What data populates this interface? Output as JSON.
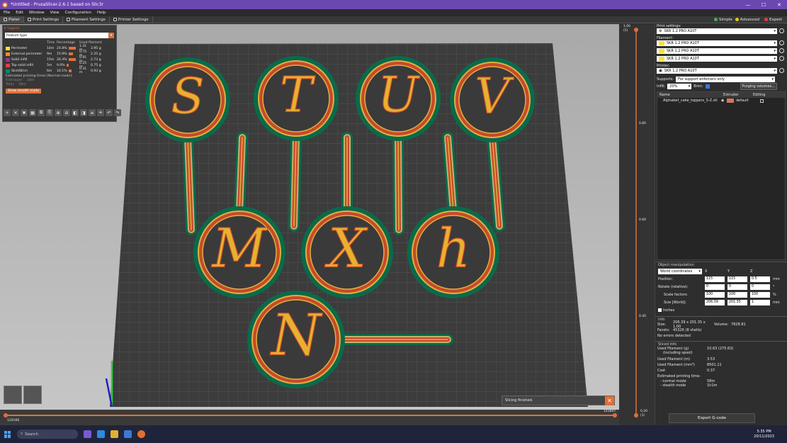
{
  "window": {
    "title": "*Untitled - PrusaSlicer-2.6.1 based on Slic3r",
    "minimize": "—",
    "maximize": "☐",
    "close": "✕"
  },
  "menu": [
    "File",
    "Edit",
    "Window",
    "View",
    "Configuration",
    "Help"
  ],
  "tabs": [
    {
      "label": "Plater",
      "icon": "plater-icon"
    },
    {
      "label": "Print Settings",
      "icon": "print-settings-icon"
    },
    {
      "label": "Filament Settings",
      "icon": "filament-icon"
    },
    {
      "label": "Printer Settings",
      "icon": "printer-icon"
    }
  ],
  "modes": [
    {
      "label": "Simple",
      "color": "#4caf50"
    },
    {
      "label": "Advanced",
      "color": "#f0c419"
    },
    {
      "label": "Expert",
      "color": "#e0403a"
    }
  ],
  "legend": {
    "title": "Legend",
    "view_type": "Feature type",
    "headers": {
      "time": "Time",
      "percentage": "Percentage",
      "used": "Used filament"
    },
    "rows": [
      {
        "name": "Perimeter",
        "color": "#f7e23a",
        "time": "14m",
        "pct": "24.8%",
        "pct_value": 24.8,
        "len": "1.31 m",
        "weight": "3.95 g"
      },
      {
        "name": "External perimeter",
        "color": "#f28c28",
        "time": "9m",
        "pct": "15.9%",
        "pct_value": 15.9,
        "len": "0.75 m",
        "weight": "2.25 g"
      },
      {
        "name": "Solid infill",
        "color": "#a03090",
        "time": "15m",
        "pct": "26.4%",
        "pct_value": 26.4,
        "len": "0.91 m",
        "weight": "2.73 g"
      },
      {
        "name": "Top solid infill",
        "color": "#e04040",
        "time": "5m",
        "pct": "9.0%",
        "pct_value": 9.0,
        "len": "0.25 m",
        "weight": "0.75 g"
      },
      {
        "name": "Skirt/Brim",
        "color": "#0a8a62",
        "time": "6m",
        "pct": "10.1%",
        "pct_value": 10.1,
        "len": "0.31 m",
        "weight": "0.93 g"
      }
    ],
    "estimated": "Estimated printing times [Normal mode]:",
    "first_layer_label": "First layer:",
    "first_layer_value": "18m",
    "total_label": "Total:",
    "total_value": "58m",
    "stealth_button": "Show stealth mode"
  },
  "toolbar_icons": [
    "add-icon",
    "delete-icon",
    "delete-all-icon",
    "arrange-icon",
    "copy-icon",
    "paste-icon",
    "add-instance-icon",
    "remove-instance-icon",
    "split-objects-icon",
    "split-parts-icon",
    "layers-editing-icon",
    "variable-layer-icon",
    "undo-icon",
    "redo-icon"
  ],
  "right": {
    "print_settings_label": "Print settings:",
    "print_profile": "SKR 1.2 PRO A10T",
    "filament_label": "Filament:",
    "filaments": [
      "SKR 1.2 PRO A10T",
      "SKR 1.2 PRO A10T",
      "SKR 1.2 PRO A10T"
    ],
    "filament_color": "#f4e43a",
    "printer_label": "Printer:",
    "printer_profile": "SKR 1.2 PRO A10T",
    "supports_label": "Supports:",
    "supports_value": "For support enforcers only",
    "infill_label": "Infill:",
    "infill_value": "20%",
    "brim_label": "Brim:",
    "purging_button": "Purging volumes...",
    "list_headers": {
      "name": "Name",
      "extruder": "Extruder",
      "editing": "Editing"
    },
    "object": {
      "name": "Alphabet_cake_toppers_S-Z.stl",
      "extruder": "default",
      "extruder_color": "#d0785a"
    },
    "object_manipulation": {
      "title": "Object manipulation",
      "coords": "World coordinates",
      "axes": [
        "X",
        "Y",
        "Z"
      ],
      "position_label": "Position:",
      "position": [
        "115",
        "115",
        "0.5"
      ],
      "position_unit": "mm",
      "rotate_label": "Rotate (relative):",
      "rotate": [
        "0",
        "0",
        "0"
      ],
      "rotate_unit": "°",
      "scale_label": "Scale factors:",
      "scale": [
        "100",
        "100",
        "100"
      ],
      "scale_unit": "%",
      "size_label": "Size [World]:",
      "size": [
        "206.39",
        "201.35",
        "1"
      ],
      "size_unit": "mm",
      "inches_label": "Inches"
    },
    "info": {
      "title": "Info",
      "size_label": "Size:",
      "size_value": "206.39 x 201.35 x 1.00",
      "volume_label": "Volume:",
      "volume_value": "7828.81",
      "facets_label": "Facets:",
      "facets_value": "45326 (8 shells)",
      "errors": "No errors detected"
    },
    "sliced": {
      "title": "Sliced Info",
      "rows": [
        {
          "k": "Used Filament (g)",
          "k2": "(including spool)",
          "v": "10.63 (275.63)"
        },
        {
          "k": "Used Filament (m)",
          "v": "3.53"
        },
        {
          "k": "Used Filament (mm³)",
          "v": "8501.11"
        },
        {
          "k": "Cost",
          "v": "0.37"
        }
      ],
      "est_label": "Estimated printing time:",
      "normal_label": "- normal mode",
      "normal_value": "58m",
      "stealth_label": "- stealth mode",
      "stealth_value": "1h1m"
    },
    "export_button": "Export G-code"
  },
  "vslider": {
    "top_value": "1.00",
    "top_layer": "(5)",
    "bottom_value": "0.20",
    "bottom_layer": "(1)",
    "ticks": [
      "0.80",
      "0.60",
      "0.40"
    ]
  },
  "hslider": {
    "left": "120166",
    "right": "143847"
  },
  "toast": "Slicing finished.",
  "letters": [
    "S",
    "T",
    "U",
    "V",
    "M",
    "X",
    "h",
    "N"
  ],
  "taskbar": {
    "search": "Search",
    "time": "5:35 PM",
    "date": "20/11/2023"
  }
}
